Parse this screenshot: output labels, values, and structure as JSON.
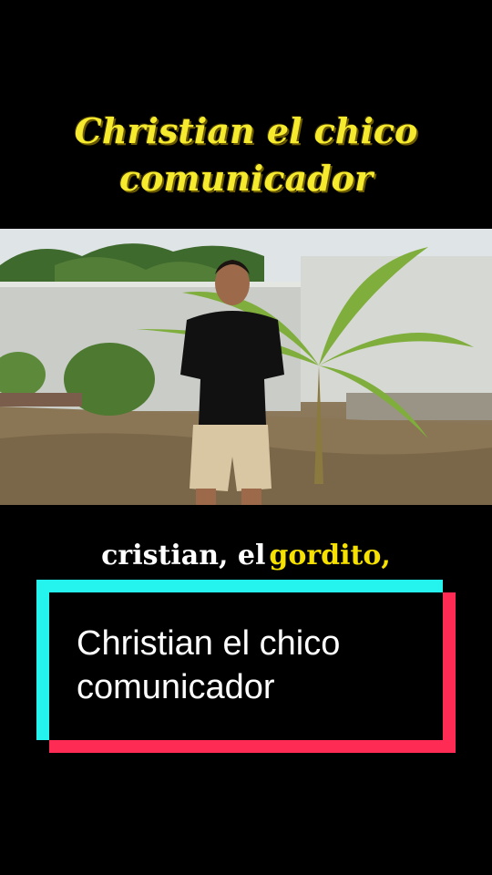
{
  "top_title": {
    "line1": "Christian el chico",
    "line2": "comunicador"
  },
  "caption": {
    "part1": "cristian, el",
    "part2": "gordito,"
  },
  "card": {
    "line1": "Christian el chico",
    "line2": "comunicador"
  },
  "colors": {
    "title_yellow": "#f6ea2e",
    "caption_yellow": "#f5e000",
    "cyan": "#25f4ee",
    "red": "#fe2c55"
  }
}
